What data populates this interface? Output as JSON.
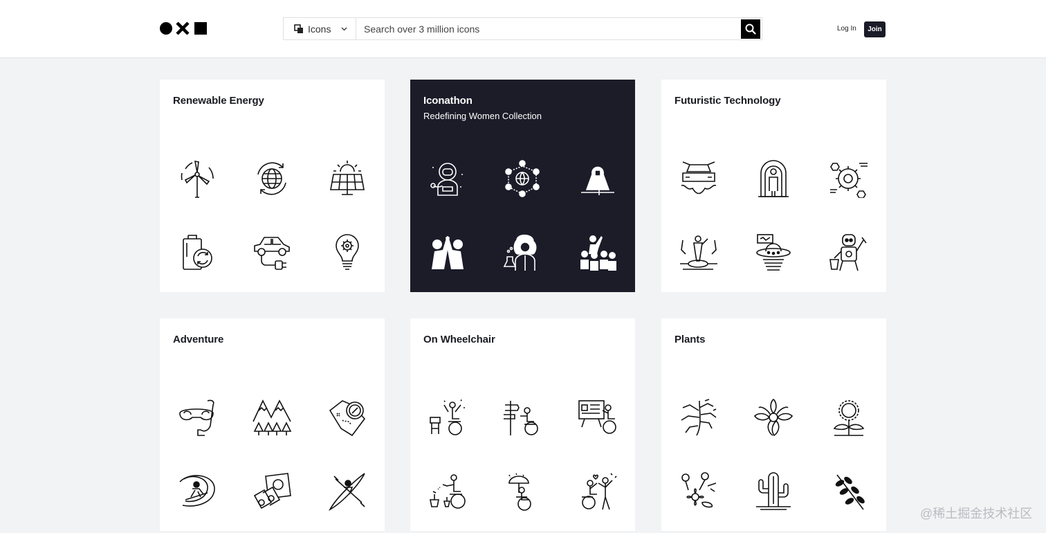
{
  "header": {
    "search_type": "Icons",
    "search_placeholder": "Search over 3 million icons",
    "login_label": "Log In",
    "join_label": "Join"
  },
  "cards": [
    {
      "title": "Renewable Energy",
      "subtitle": "",
      "theme": "light",
      "icons": [
        "wind-turbine-icon",
        "globe-recycle-icon",
        "solar-panel-icon",
        "battery-recycle-icon",
        "electric-car-icon",
        "lightbulb-gear-icon"
      ]
    },
    {
      "title": "Iconathon",
      "subtitle": "Redefining Women Collection",
      "theme": "dark",
      "icons": [
        "astronaut-woman-icon",
        "women-network-icon",
        "hijab-woman-icon",
        "high-five-icon",
        "scientist-woman-icon",
        "women-group-icon"
      ]
    },
    {
      "title": "Futuristic Technology",
      "subtitle": "",
      "theme": "light",
      "icons": [
        "flying-car-icon",
        "cryo-pod-icon",
        "gear-network-icon",
        "hologram-person-icon",
        "ufo-icon",
        "robot-chef-icon"
      ]
    },
    {
      "title": "Adventure",
      "subtitle": "",
      "theme": "light",
      "icons": [
        "snorkel-mask-icon",
        "mountains-forest-icon",
        "map-compass-icon",
        "surfer-icon",
        "passport-binoculars-icon",
        "kayak-icon"
      ]
    },
    {
      "title": "On Wheelchair",
      "subtitle": "",
      "theme": "light",
      "icons": [
        "wheelchair-cheer-icon",
        "wheelchair-signpost-icon",
        "wheelchair-presentation-icon",
        "wheelchair-gardening-icon",
        "wheelchair-umbrella-icon",
        "wheelchair-friends-icon"
      ]
    },
    {
      "title": "Plants",
      "subtitle": "",
      "theme": "light",
      "icons": [
        "bamboo-branch-icon",
        "lotus-flower-icon",
        "sunflower-icon",
        "flowers-bunch-icon",
        "cactus-icon",
        "leafy-branch-icon"
      ]
    }
  ],
  "watermark": "@稀土掘金技术社区"
}
